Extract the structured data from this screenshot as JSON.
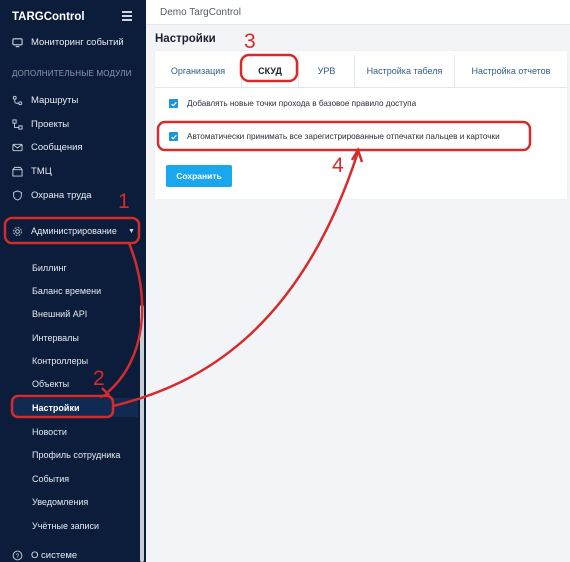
{
  "app": {
    "brand": "TARGControl",
    "workspace": "Demo TargControl"
  },
  "sidebar": {
    "top_items": [
      {
        "label": "Мониторинг событий",
        "icon": "monitor-icon"
      }
    ],
    "section_label": "ДОПОЛНИТЕЛЬНЫЕ МОДУЛИ",
    "modules": [
      {
        "label": "Маршруты",
        "icon": "route-icon"
      },
      {
        "label": "Проекты",
        "icon": "project-icon"
      },
      {
        "label": "Сообщения",
        "icon": "mail-icon"
      },
      {
        "label": "ТМЦ",
        "icon": "box-icon"
      },
      {
        "label": "Охрана труда",
        "icon": "shield-icon"
      }
    ],
    "admin": {
      "label": "Администрирование",
      "icon": "gear-icon"
    },
    "admin_items": [
      "Биллинг",
      "Баланс времени",
      "Внешний API",
      "Интервалы",
      "Контроллеры",
      "Объекты",
      "Настройки",
      "Новости",
      "Профиль сотрудника",
      "События",
      "Уведомления",
      "Учётные записи"
    ],
    "active_item": "Настройки",
    "about": {
      "label": "О системе",
      "icon": "help-icon"
    }
  },
  "page": {
    "title": "Настройки"
  },
  "tabs": [
    {
      "label": "Организация"
    },
    {
      "label": "СКУД"
    },
    {
      "label": "УРВ"
    },
    {
      "label": "Настройка табеля"
    },
    {
      "label": "Настройка отчетов"
    }
  ],
  "active_tab": "СКУД",
  "options": [
    {
      "label": "Добавлять новые точки прохода в базовое правило доступа",
      "checked": true
    },
    {
      "label": "Автоматически принимать все зарегистрированные отпечатки пальцев и карточки",
      "checked": true
    }
  ],
  "save_label": "Сохранить",
  "annotations": {
    "n1": "1",
    "n2": "2",
    "n3": "3",
    "n4": "4",
    "color": "#d62b2b"
  },
  "colors": {
    "sidebar_bg": "#0b1d3a",
    "accent": "#1aa7ee",
    "checkbox": "#1b96d4"
  }
}
